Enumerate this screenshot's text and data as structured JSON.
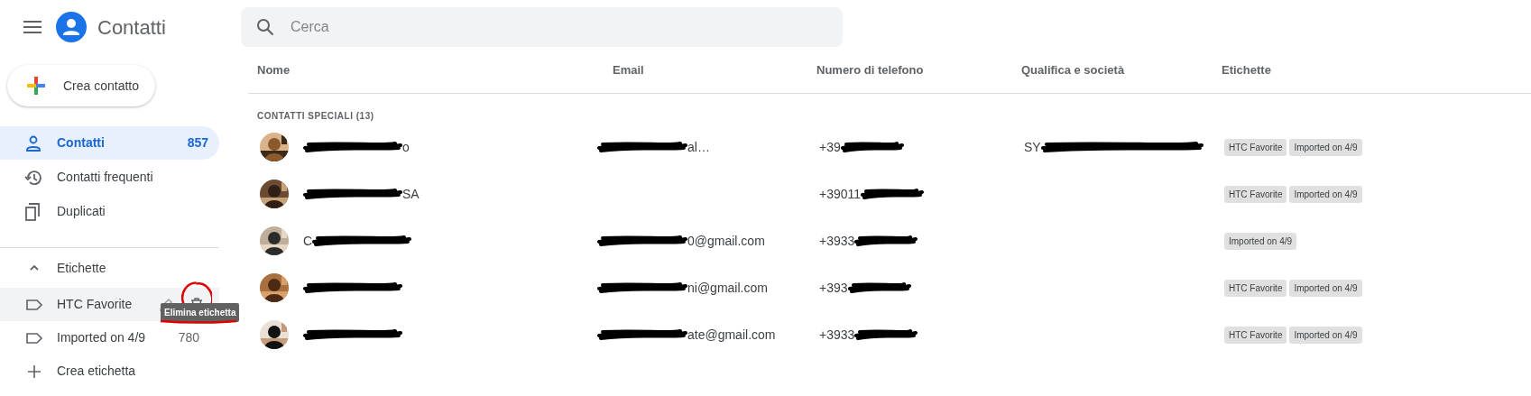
{
  "app": {
    "title": "Contatti"
  },
  "search": {
    "placeholder": "Cerca"
  },
  "create_button": "Crea contatto",
  "nav": [
    {
      "label": "Contatti",
      "count": "857",
      "selected": true
    },
    {
      "label": "Contatti frequenti",
      "selected": false
    },
    {
      "label": "Duplicati",
      "selected": false
    }
  ],
  "labels": {
    "title": "Etichette",
    "expanded": true,
    "items": [
      {
        "label": "HTC Favorite",
        "hovered": true
      },
      {
        "label": "Imported on 4/9",
        "count": "780",
        "hovered": false
      }
    ],
    "create": "Crea etichetta"
  },
  "tooltip": "Elimina etichetta",
  "table": {
    "columns": [
      "Nome",
      "Email",
      "Numero di telefono",
      "Qualifica e società",
      "Etichette"
    ],
    "section": "CONTATTI SPECIALI (13)",
    "rows": [
      {
        "name": {
          "redacted": true,
          "suffix": "o"
        },
        "email": {
          "redacted": true,
          "suffix": "al…"
        },
        "phone": {
          "prefix": "+39",
          "redacted": true
        },
        "company": {
          "prefix": "SY",
          "redacted": true
        },
        "tags": [
          "HTC Favorite",
          "Imported on 4/9"
        ]
      },
      {
        "name": {
          "redacted": true,
          "suffix": "SA"
        },
        "phone": {
          "prefix": "+39011",
          "redacted": true
        },
        "tags": [
          "HTC Favorite",
          "Imported on 4/9"
        ]
      },
      {
        "name": {
          "prefix": "C",
          "redacted": true
        },
        "email": {
          "redacted": true,
          "suffix": "0@gmail.com"
        },
        "phone": {
          "prefix": "+3933",
          "redacted": true
        },
        "tags": [
          "Imported on 4/9"
        ]
      },
      {
        "name": {
          "redacted": true
        },
        "email": {
          "redacted": true,
          "suffix": "ni@gmail.com"
        },
        "phone": {
          "prefix": "+393",
          "redacted": true
        },
        "tags": [
          "HTC Favorite",
          "Imported on 4/9"
        ]
      },
      {
        "name": {
          "redacted": true
        },
        "email": {
          "redacted": true,
          "suffix": "ate@gmail.com"
        },
        "phone": {
          "prefix": "+3933",
          "redacted": true
        },
        "tags": [
          "HTC Favorite",
          "Imported on 4/9"
        ]
      }
    ]
  }
}
